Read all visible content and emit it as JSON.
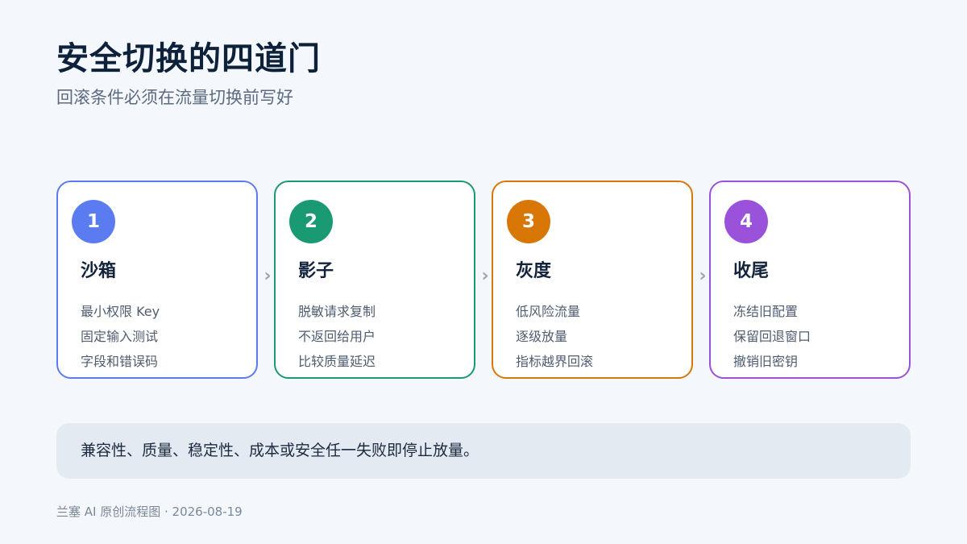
{
  "header": {
    "title": "安全切换的四道门",
    "subtitle": "回滚条件必须在流量切换前写好"
  },
  "steps": [
    {
      "number": "1",
      "title": "沙箱",
      "lines": [
        "最小权限 Key",
        "固定输入测试",
        "字段和错误码"
      ],
      "color": "#5b7cf0"
    },
    {
      "number": "2",
      "title": "影子",
      "lines": [
        "脱敏请求复制",
        "不返回给用户",
        "比较质量延迟"
      ],
      "color": "#1a9a72"
    },
    {
      "number": "3",
      "title": "灰度",
      "lines": [
        "低风险流量",
        "逐级放量",
        "指标越界回滚"
      ],
      "color": "#d97706"
    },
    {
      "number": "4",
      "title": "收尾",
      "lines": [
        "冻结旧配置",
        "保留回退窗口",
        "撤销旧密钥"
      ],
      "color": "#9a52db"
    }
  ],
  "arrow_glyph": "›",
  "notice": {
    "text": "兼容性、质量、稳定性、成本或安全任一失败即停止放量。"
  },
  "footer": {
    "text": "兰塞 AI 原创流程图 · 2026-08-19"
  }
}
